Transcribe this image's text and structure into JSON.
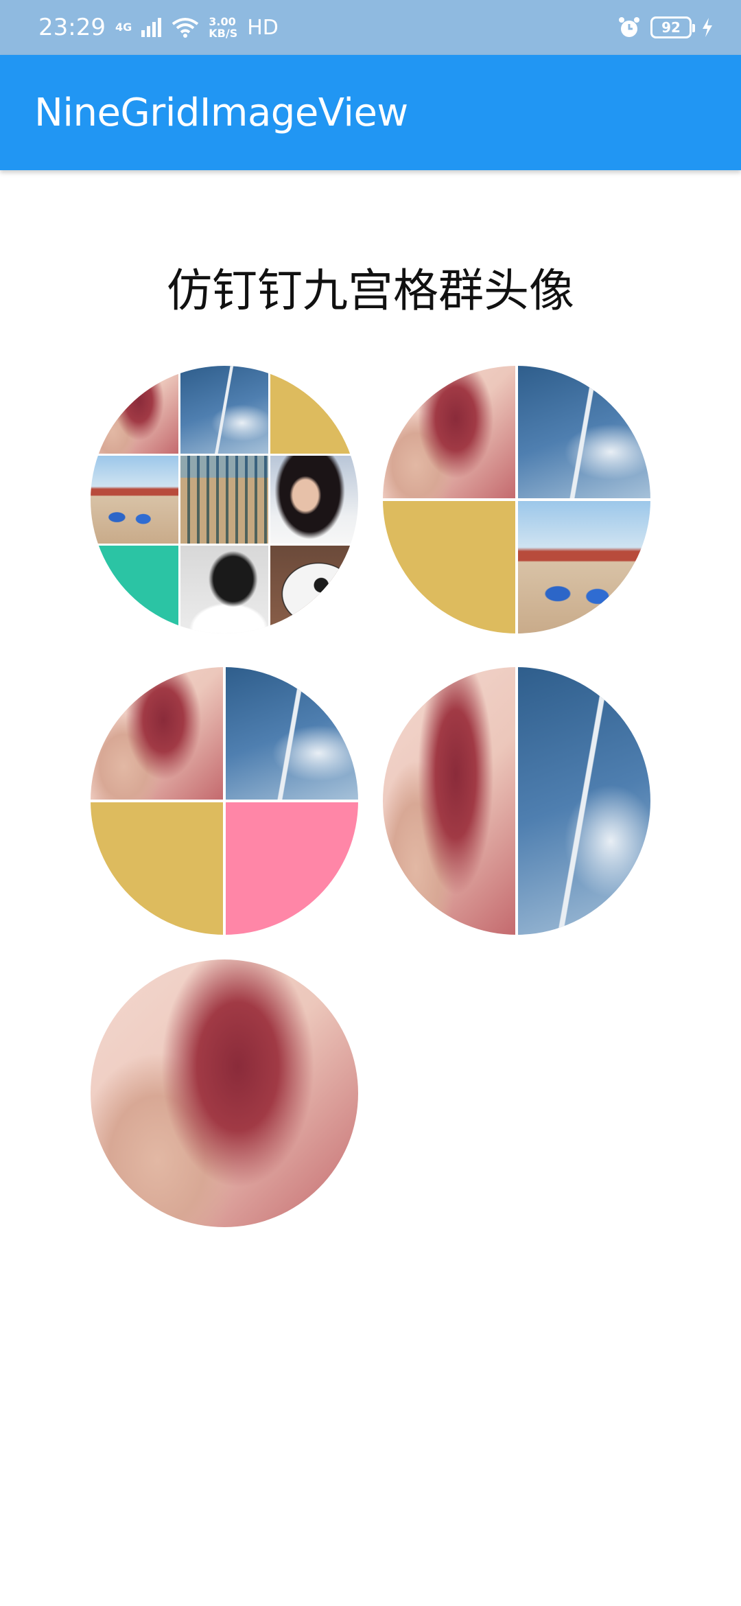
{
  "status_bar": {
    "time": "23:29",
    "network_type": "4G",
    "speed_value": "3.00",
    "speed_unit": "KB/S",
    "hd_label": "HD",
    "battery": "92",
    "icons": [
      "signal-icon",
      "wifi-icon",
      "alarm-icon",
      "battery-icon",
      "charging-icon"
    ]
  },
  "app_bar": {
    "title": "NineGridImageView",
    "color": "#2196f3"
  },
  "main": {
    "heading": "仿钉钉九宫格群头像",
    "groups": [
      {
        "name": "nine-cell-group",
        "cells": [
          "hair",
          "turbine",
          "yellow",
          "beach",
          "building",
          "woman",
          "teal",
          "bw",
          "panda"
        ]
      },
      {
        "name": "four-cell-group-a",
        "cells": [
          "hair",
          "turbine",
          "yellow",
          "beach"
        ]
      },
      {
        "name": "four-cell-group-b",
        "cells": [
          "hair",
          "turbine",
          "yellow",
          "pink"
        ]
      },
      {
        "name": "two-cell-group",
        "cells": [
          "hair",
          "turbine"
        ]
      },
      {
        "name": "single-cell-group",
        "cells": [
          "hair"
        ]
      }
    ],
    "colors": {
      "yellow": "#ddbb5e",
      "teal": "#2bc4a4",
      "pink": "#ff86a7",
      "divider": "#ffffff"
    }
  }
}
